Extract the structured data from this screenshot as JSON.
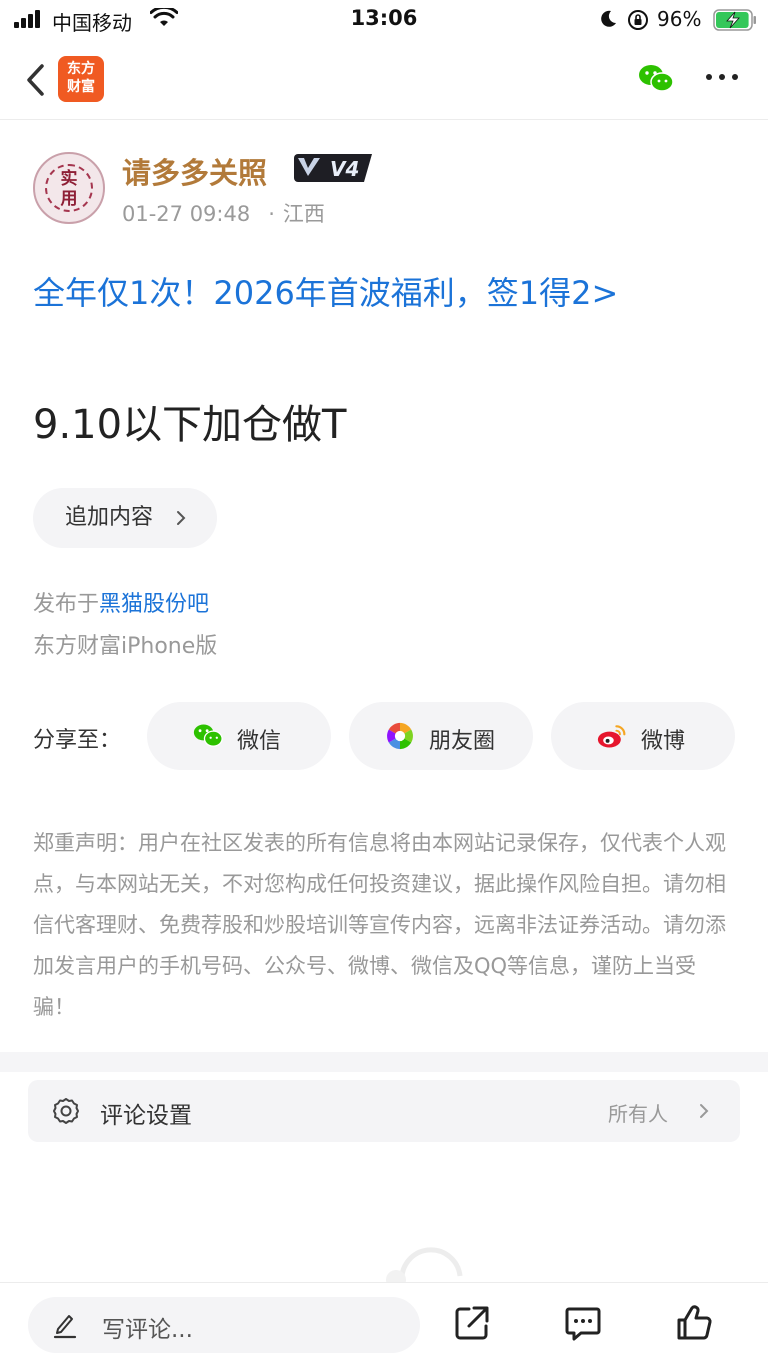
{
  "status_bar": {
    "carrier": "中国移动",
    "time": "13:06",
    "battery_percent": "96%",
    "battery_level": 0.96
  },
  "nav": {
    "app_logo_text": "东方\n财富",
    "share_icon": "wechat-icon",
    "more_icon": "more-dots-icon"
  },
  "post": {
    "author": "请多多关照",
    "avatar_text": "实用",
    "level_badge": "V4",
    "date": "01-27 09:48",
    "location": "江西",
    "promo_link": "全年仅1次！2026年首波福利，签1得2>",
    "body": "9.10以下加仓做T",
    "append_button": "追加内容",
    "published_prefix": "发布于",
    "forum_name": "黑猫股份吧",
    "client": "东方财富iPhone版"
  },
  "share": {
    "label": "分享至：",
    "targets": [
      {
        "label": "微信",
        "icon": "wechat-icon"
      },
      {
        "label": "朋友圈",
        "icon": "moments-icon"
      },
      {
        "label": "微博",
        "icon": "weibo-icon"
      }
    ]
  },
  "disclaimer": "郑重声明：用户在社区发表的所有信息将由本网站记录保存，仅代表个人观点，与本网站无关，不对您构成任何投资建议，据此操作风险自担。请勿相信代客理财、免费荐股和炒股培训等宣传内容，远离非法证券活动。请勿添加发言用户的手机号码、公众号、微博、微信及QQ等信息，谨防上当受骗！",
  "comment_setting": {
    "label": "评论设置",
    "value": "所有人"
  },
  "bottom_bar": {
    "comment_placeholder": "写评论...",
    "icons": [
      "share-out-icon",
      "comment-icon",
      "like-icon"
    ]
  },
  "colors": {
    "link_blue": "#1b73d8",
    "author_gold": "#b27a3a",
    "brand_orange": "#f05a22",
    "wechat_green": "#2dc100"
  }
}
